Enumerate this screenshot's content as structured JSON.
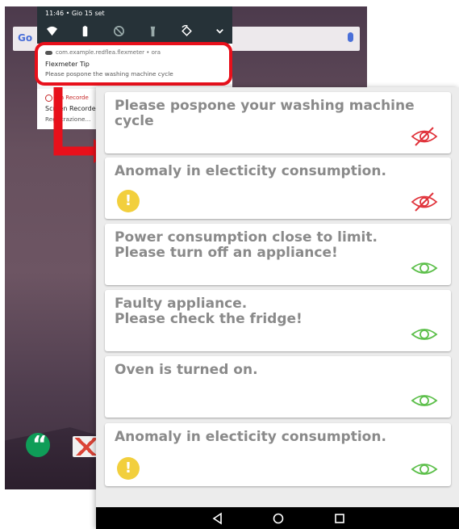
{
  "status_bar": {
    "time": "11:46 • Gio 15 set"
  },
  "quick_settings": {
    "icons": [
      "wifi-icon",
      "battery-icon",
      "dnd-off-icon",
      "flashlight-off-icon",
      "auto-rotate-icon",
      "expand-chevron-icon"
    ]
  },
  "notifications": [
    {
      "app_package": "com.example.redflea.flexmeter • ora",
      "title": "Flexmeter Tip",
      "text": "Please pospone the washing machine cycle"
    },
    {
      "app_line": "een Recorde",
      "title": "Screen Recorder S",
      "text": "Registrazione..."
    }
  ],
  "home": {
    "search_logo": "Go",
    "dock_icons": [
      "hangouts-icon",
      "gmail-icon"
    ]
  },
  "colors": {
    "highlight": "#e8101b",
    "alert_eye": "#e0323a",
    "ok_eye": "#5cbf4a",
    "warning_badge": "#f2cf3d",
    "card_text": "#8a8a8a"
  },
  "cards": [
    {
      "message": "Please pospone your washing machine cycle",
      "warning": false,
      "eye": "eye-crossed-red-icon"
    },
    {
      "message": "Anomaly in electicity consumption.",
      "warning": true,
      "eye": "eye-crossed-red-icon"
    },
    {
      "message": "Power consumption close to limit.\nPlease turn off an appliance!",
      "warning": false,
      "eye": "eye-green-icon"
    },
    {
      "message": "Faulty appliance.\nPlease check the fridge!",
      "warning": false,
      "eye": "eye-green-icon"
    },
    {
      "message": "Oven is turned on.",
      "warning": false,
      "eye": "eye-green-icon"
    },
    {
      "message": "Anomaly in electicity consumption.",
      "warning": true,
      "eye": "eye-green-icon"
    }
  ],
  "warning_symbol": "!",
  "navbar": [
    "back-icon",
    "home-icon",
    "recents-icon"
  ]
}
